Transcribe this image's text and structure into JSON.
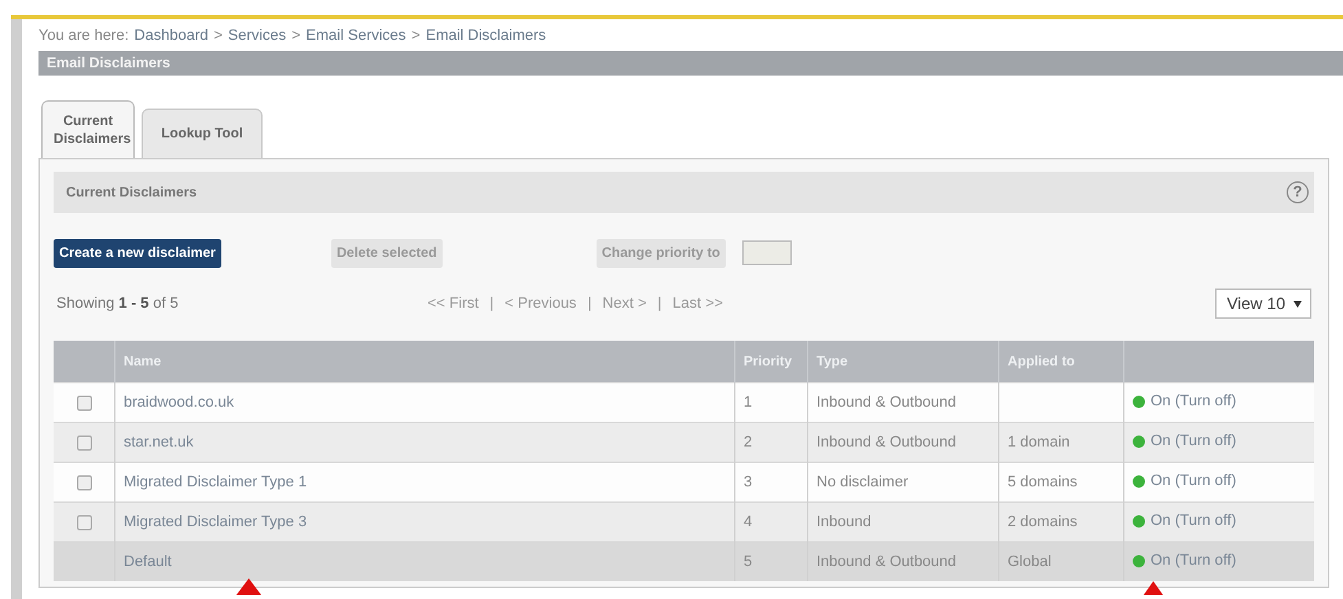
{
  "breadcrumb": {
    "prefix": "You are here:",
    "items": [
      "Dashboard",
      "Services",
      "Email Services",
      "Email Disclaimers"
    ],
    "separator": ">"
  },
  "page_title": "Email Disclaimers",
  "tabs": [
    {
      "label": "Current Disclaimers",
      "selected": true
    },
    {
      "label": "Lookup Tool",
      "selected": false
    }
  ],
  "panel": {
    "title": "Current Disclaimers",
    "help": "?"
  },
  "toolbar": {
    "create_button": "Create a new disclaimer",
    "delete_button": "Delete selected",
    "priority_button": "Change priority to"
  },
  "pagination": {
    "showing": "Showing **1 - 5** of 5",
    "links": [
      "<< First",
      "< Previous",
      "Next >",
      "Last >>"
    ],
    "separator": "|",
    "view": "View 10"
  },
  "table": {
    "columns": [
      "Name",
      "Priority",
      "Type",
      "Applied to"
    ],
    "rows": [
      {
        "kind": "custom",
        "checked": false,
        "name": "braidwood.co.uk",
        "priority": "1",
        "type": "Inbound & Outbound",
        "applied_to": "",
        "on": true,
        "status": "On (Turn off)"
      },
      {
        "kind": "custom",
        "checked": false,
        "name": "star.net.uk",
        "priority": "2",
        "type": "Inbound & Outbound",
        "applied_to": "1 domain",
        "on": true,
        "status": "On (Turn off)"
      },
      {
        "kind": "custom",
        "checked": false,
        "name": "Migrated Disclaimer Type 1",
        "priority": "3",
        "type": "No disclaimer",
        "applied_to": "5 domains",
        "on": true,
        "status": "On (Turn off)"
      },
      {
        "kind": "custom",
        "checked": false,
        "name": "Migrated Disclaimer Type 3",
        "priority": "4",
        "type": "Inbound",
        "applied_to": "2 domains",
        "on": true,
        "status": "On (Turn off)"
      },
      {
        "kind": "default",
        "name": "Default",
        "priority": "5",
        "type": "Inbound & Outbound",
        "applied_to": "Global",
        "on": true,
        "status": "On (Turn off)"
      }
    ]
  }
}
